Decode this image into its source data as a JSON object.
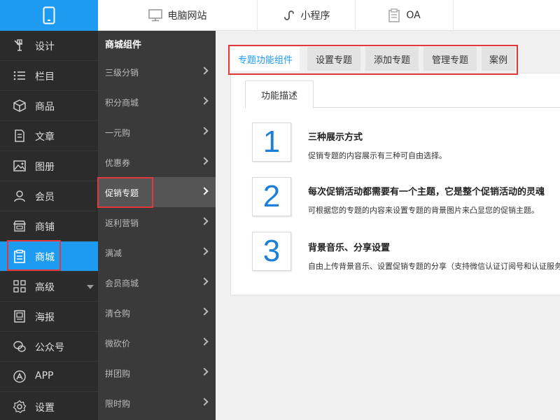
{
  "topbar": {
    "tabs": [
      {
        "label": "电脑网站",
        "icon": "monitor-icon"
      },
      {
        "label": "小程序",
        "icon": "mini-program-icon"
      },
      {
        "label": "OA",
        "icon": "clipboard-icon"
      }
    ],
    "logo_icon": "mobile-phone-icon"
  },
  "sidebar": {
    "items": [
      {
        "label": "设计",
        "icon": "design-tool-icon"
      },
      {
        "label": "栏目",
        "icon": "list-icon"
      },
      {
        "label": "商品",
        "icon": "box-icon"
      },
      {
        "label": "文章",
        "icon": "document-icon"
      },
      {
        "label": "图册",
        "icon": "image-icon"
      },
      {
        "label": "会员",
        "icon": "user-icon"
      },
      {
        "label": "商铺",
        "icon": "store-icon"
      },
      {
        "label": "商城",
        "icon": "clipboard-icon",
        "active": true
      },
      {
        "label": "高级",
        "icon": "grid-icon"
      },
      {
        "label": "海报",
        "icon": "poster-icon"
      },
      {
        "label": "公众号",
        "icon": "wechat-icon"
      },
      {
        "label": "APP",
        "icon": "app-store-icon"
      },
      {
        "label": "设置",
        "icon": "gear-icon"
      }
    ]
  },
  "subbar": {
    "title": "商城组件",
    "items": [
      {
        "label": "三级分销"
      },
      {
        "label": "积分商城"
      },
      {
        "label": "一元购"
      },
      {
        "label": "优惠券"
      },
      {
        "label": "促销专题",
        "active": true
      },
      {
        "label": "返利营销"
      },
      {
        "label": "满减"
      },
      {
        "label": "会员商城"
      },
      {
        "label": "清仓购"
      },
      {
        "label": "微砍价"
      },
      {
        "label": "拼团购"
      },
      {
        "label": "限时购"
      }
    ]
  },
  "content": {
    "tabs": [
      {
        "label": "专题功能组件",
        "active": true
      },
      {
        "label": "设置专题"
      },
      {
        "label": "添加专题"
      },
      {
        "label": "管理专题"
      },
      {
        "label": "案例"
      }
    ],
    "panel_tab": "功能描述",
    "features": [
      {
        "num": "1",
        "title": "三种展示方式",
        "desc": "促销专题的内容展示有三种可自由选择。"
      },
      {
        "num": "2",
        "title": "每次促销活动都需要有一个主题，它是整个促销活动的灵魂",
        "desc": "可根据您的专题的内容来设置专题的背景图片来凸显您的促销主题。"
      },
      {
        "num": "3",
        "title": "背景音乐、分享设置",
        "desc": "自由上传背景音乐、设置促销专题的分享（支持微信认证订阅号和认证服务号）"
      }
    ]
  },
  "colors": {
    "accent": "#1d9bf0",
    "highlight": "#e4393c",
    "sidebar_bg": "#2b2b2b",
    "subbar_bg": "#3a3a3a"
  }
}
